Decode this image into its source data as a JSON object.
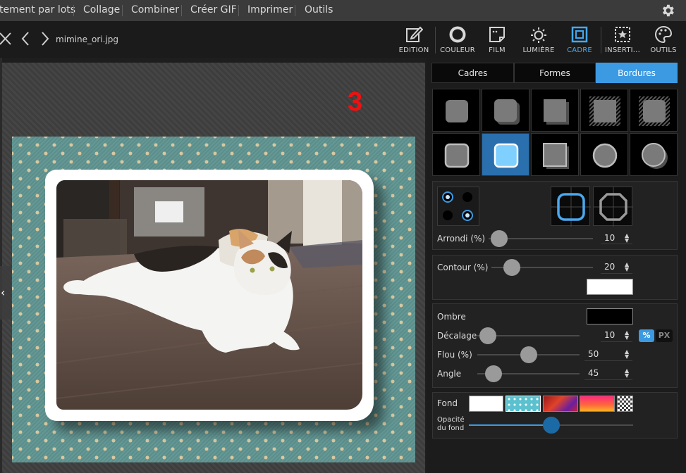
{
  "menu": {
    "items": [
      "tement par lots",
      "Collage",
      "Combiner",
      "Créer GIF",
      "Imprimer",
      "Outils"
    ],
    "settings_icon": "gear-icon"
  },
  "toolbar": {
    "filename": "mimine_ori.jpg",
    "tools": [
      {
        "label": "EDITION",
        "icon": "edit-icon"
      },
      {
        "label": "COULEUR",
        "icon": "color-ring-icon"
      },
      {
        "label": "FILM",
        "icon": "film-icon"
      },
      {
        "label": "LUMIÈRE",
        "icon": "sun-icon"
      },
      {
        "label": "CADRE",
        "icon": "frame-icon",
        "active": true
      },
      {
        "label": "INSERTI...",
        "icon": "insert-icon"
      },
      {
        "label": "OUTILS",
        "icon": "palette-icon"
      }
    ]
  },
  "canvas": {
    "annotation_number": "3",
    "photo_subject": "calico-cat-photo"
  },
  "panel": {
    "tabs": [
      {
        "label": "Cadres"
      },
      {
        "label": "Formes"
      },
      {
        "label": "Bordures",
        "active": true
      }
    ],
    "border_styles_selected": 7,
    "rounding": {
      "label": "Arrondi (%)",
      "value": "10",
      "fraction": 0.1
    },
    "contour": {
      "label": "Contour (%)",
      "value": "20",
      "fraction": 0.2,
      "color": "#ffffff"
    },
    "shadow": {
      "label": "Ombre",
      "color": "#000000",
      "offset": {
        "label": "Décalage",
        "value": "10",
        "fraction": 0.1
      },
      "unit_percent": "%",
      "unit_px": "PX",
      "blur": {
        "label": "Flou (%)",
        "value": "50",
        "fraction": 0.5
      },
      "angle": {
        "label": "Angle",
        "value": "45",
        "fraction": 0.16
      }
    },
    "background": {
      "label": "Fond",
      "opacity_label_1": "Opacité",
      "opacity_label_2": "du fond",
      "opacity_fraction": 0.5
    }
  },
  "colors": {
    "accent": "#3c9ae3",
    "arrow_annotation": "#f5f20c"
  }
}
